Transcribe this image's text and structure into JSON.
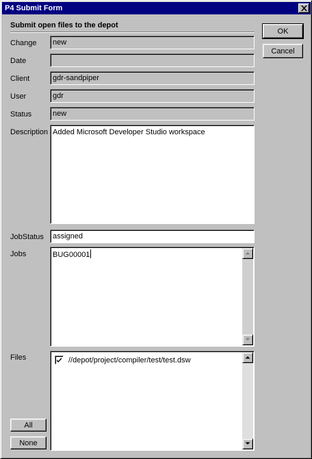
{
  "window": {
    "title": "P4 Submit Form"
  },
  "form": {
    "heading": "Submit open files to the depot",
    "change": {
      "label": "Change",
      "value": "new"
    },
    "date": {
      "label": "Date",
      "value": ""
    },
    "client": {
      "label": "Client",
      "value": "gdr-sandpiper"
    },
    "user": {
      "label": "User",
      "value": "gdr"
    },
    "status": {
      "label": "Status",
      "value": "new"
    },
    "description": {
      "label": "Description",
      "value": "Added Microsoft Developer Studio workspace"
    },
    "jobstatus": {
      "label": "JobStatus",
      "value": "assigned"
    },
    "jobs": {
      "label": "Jobs",
      "value": "BUG00001"
    },
    "files": {
      "label": "Files",
      "items": [
        {
          "path": "//depot/project/compiler/test/test.dsw",
          "checked": true
        }
      ]
    }
  },
  "buttons": {
    "ok": "OK",
    "cancel": "Cancel",
    "all": "All",
    "none": "None"
  },
  "icons": {
    "close": "close-icon",
    "check": "check-icon",
    "up": "up-arrow-icon",
    "down": "down-arrow-icon"
  }
}
